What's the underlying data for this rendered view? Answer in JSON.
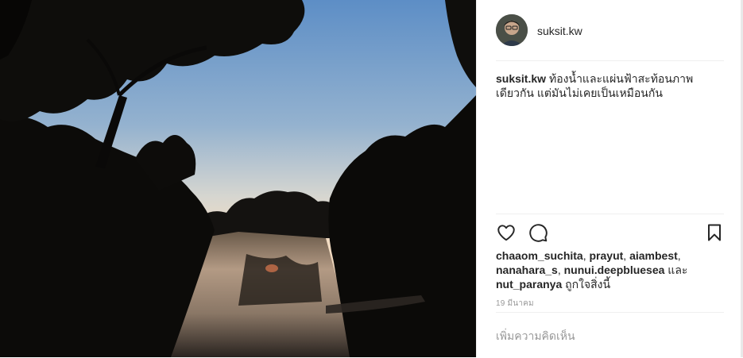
{
  "post": {
    "username": "suksit.kw",
    "caption": {
      "author": "suksit.kw",
      "text": "ท้องน้ำและแผ่นฟ้าสะท้อนภาพเดียวกัน แต่มันไม่เคยเป็นเหมือนกัน"
    },
    "likes": {
      "users": [
        "chaaom_suchita",
        "prayut",
        "aiambest",
        "nanahara_s",
        "nunui.deepbluesea",
        "nut_paranya"
      ],
      "sep": ", ",
      "and_word": " และ ",
      "suffix": " ถูกใจสิ่งนี้"
    },
    "date": "19 มีนาคม",
    "comment_placeholder": "เพิ่มความคิดเห็น"
  },
  "icons": {
    "like": "heart-icon",
    "comment": "comment-bubble-icon",
    "save": "bookmark-icon"
  },
  "colors": {
    "text": "#262626",
    "muted": "#999999",
    "divider": "#efefef",
    "sky_top": "#5f8fc4",
    "sky_horizon": "#f3dcc2"
  }
}
